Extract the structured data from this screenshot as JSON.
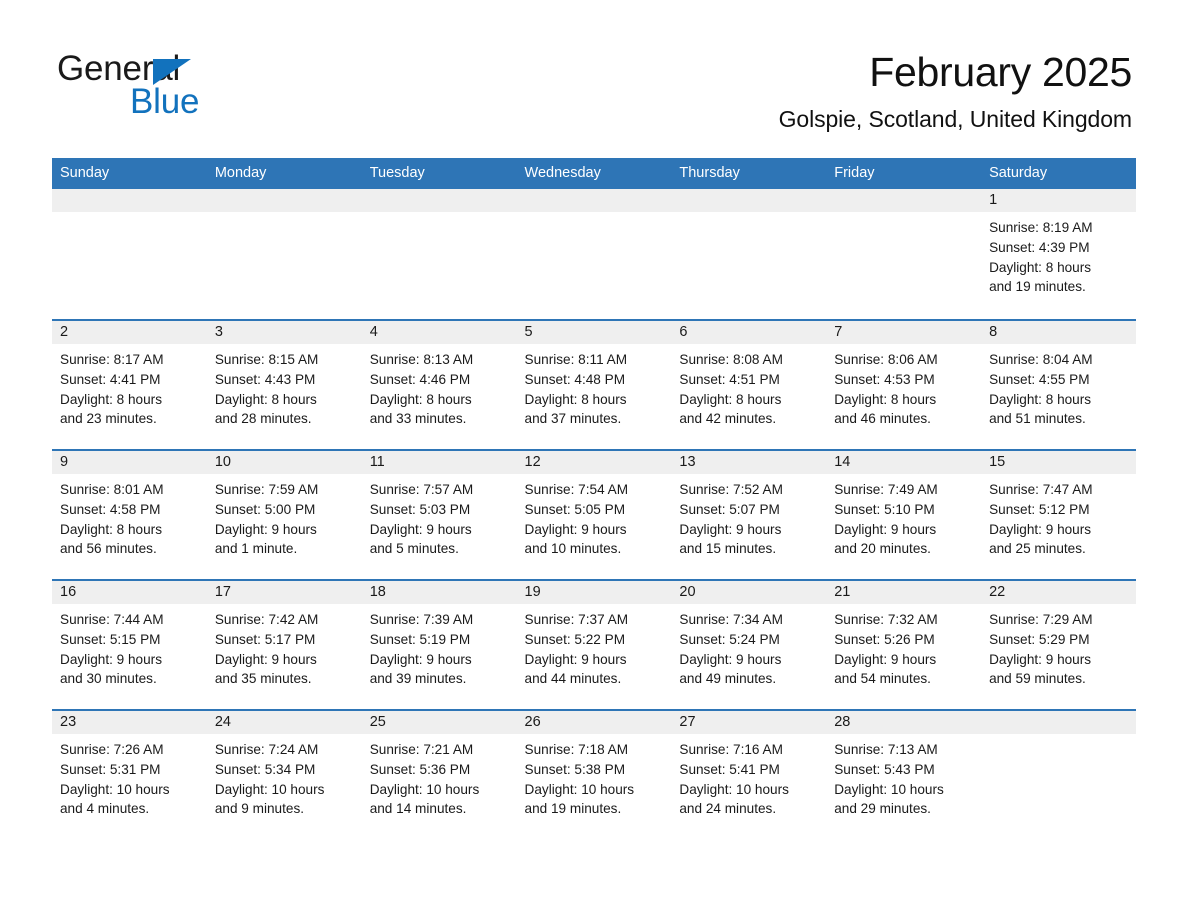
{
  "brand": {
    "name_part1": "General",
    "name_part2": "Blue",
    "logo_triangle": "triangle-icon",
    "accent_color": "#1272bd"
  },
  "header": {
    "title": "February 2025",
    "subtitle": "Golspie, Scotland, United Kingdom"
  },
  "theme": {
    "header_blue": "#2e75b6",
    "daynum_band": "#efefef",
    "text": "#1a1a1a"
  },
  "calendar": {
    "weekday_headers": [
      "Sunday",
      "Monday",
      "Tuesday",
      "Wednesday",
      "Thursday",
      "Friday",
      "Saturday"
    ],
    "weeks": [
      [
        {
          "day": "",
          "lines": []
        },
        {
          "day": "",
          "lines": []
        },
        {
          "day": "",
          "lines": []
        },
        {
          "day": "",
          "lines": []
        },
        {
          "day": "",
          "lines": []
        },
        {
          "day": "",
          "lines": []
        },
        {
          "day": "1",
          "lines": [
            "Sunrise: 8:19 AM",
            "Sunset: 4:39 PM",
            "Daylight: 8 hours",
            "and 19 minutes."
          ]
        }
      ],
      [
        {
          "day": "2",
          "lines": [
            "Sunrise: 8:17 AM",
            "Sunset: 4:41 PM",
            "Daylight: 8 hours",
            "and 23 minutes."
          ]
        },
        {
          "day": "3",
          "lines": [
            "Sunrise: 8:15 AM",
            "Sunset: 4:43 PM",
            "Daylight: 8 hours",
            "and 28 minutes."
          ]
        },
        {
          "day": "4",
          "lines": [
            "Sunrise: 8:13 AM",
            "Sunset: 4:46 PM",
            "Daylight: 8 hours",
            "and 33 minutes."
          ]
        },
        {
          "day": "5",
          "lines": [
            "Sunrise: 8:11 AM",
            "Sunset: 4:48 PM",
            "Daylight: 8 hours",
            "and 37 minutes."
          ]
        },
        {
          "day": "6",
          "lines": [
            "Sunrise: 8:08 AM",
            "Sunset: 4:51 PM",
            "Daylight: 8 hours",
            "and 42 minutes."
          ]
        },
        {
          "day": "7",
          "lines": [
            "Sunrise: 8:06 AM",
            "Sunset: 4:53 PM",
            "Daylight: 8 hours",
            "and 46 minutes."
          ]
        },
        {
          "day": "8",
          "lines": [
            "Sunrise: 8:04 AM",
            "Sunset: 4:55 PM",
            "Daylight: 8 hours",
            "and 51 minutes."
          ]
        }
      ],
      [
        {
          "day": "9",
          "lines": [
            "Sunrise: 8:01 AM",
            "Sunset: 4:58 PM",
            "Daylight: 8 hours",
            "and 56 minutes."
          ]
        },
        {
          "day": "10",
          "lines": [
            "Sunrise: 7:59 AM",
            "Sunset: 5:00 PM",
            "Daylight: 9 hours",
            "and 1 minute."
          ]
        },
        {
          "day": "11",
          "lines": [
            "Sunrise: 7:57 AM",
            "Sunset: 5:03 PM",
            "Daylight: 9 hours",
            "and 5 minutes."
          ]
        },
        {
          "day": "12",
          "lines": [
            "Sunrise: 7:54 AM",
            "Sunset: 5:05 PM",
            "Daylight: 9 hours",
            "and 10 minutes."
          ]
        },
        {
          "day": "13",
          "lines": [
            "Sunrise: 7:52 AM",
            "Sunset: 5:07 PM",
            "Daylight: 9 hours",
            "and 15 minutes."
          ]
        },
        {
          "day": "14",
          "lines": [
            "Sunrise: 7:49 AM",
            "Sunset: 5:10 PM",
            "Daylight: 9 hours",
            "and 20 minutes."
          ]
        },
        {
          "day": "15",
          "lines": [
            "Sunrise: 7:47 AM",
            "Sunset: 5:12 PM",
            "Daylight: 9 hours",
            "and 25 minutes."
          ]
        }
      ],
      [
        {
          "day": "16",
          "lines": [
            "Sunrise: 7:44 AM",
            "Sunset: 5:15 PM",
            "Daylight: 9 hours",
            "and 30 minutes."
          ]
        },
        {
          "day": "17",
          "lines": [
            "Sunrise: 7:42 AM",
            "Sunset: 5:17 PM",
            "Daylight: 9 hours",
            "and 35 minutes."
          ]
        },
        {
          "day": "18",
          "lines": [
            "Sunrise: 7:39 AM",
            "Sunset: 5:19 PM",
            "Daylight: 9 hours",
            "and 39 minutes."
          ]
        },
        {
          "day": "19",
          "lines": [
            "Sunrise: 7:37 AM",
            "Sunset: 5:22 PM",
            "Daylight: 9 hours",
            "and 44 minutes."
          ]
        },
        {
          "day": "20",
          "lines": [
            "Sunrise: 7:34 AM",
            "Sunset: 5:24 PM",
            "Daylight: 9 hours",
            "and 49 minutes."
          ]
        },
        {
          "day": "21",
          "lines": [
            "Sunrise: 7:32 AM",
            "Sunset: 5:26 PM",
            "Daylight: 9 hours",
            "and 54 minutes."
          ]
        },
        {
          "day": "22",
          "lines": [
            "Sunrise: 7:29 AM",
            "Sunset: 5:29 PM",
            "Daylight: 9 hours",
            "and 59 minutes."
          ]
        }
      ],
      [
        {
          "day": "23",
          "lines": [
            "Sunrise: 7:26 AM",
            "Sunset: 5:31 PM",
            "Daylight: 10 hours",
            "and 4 minutes."
          ]
        },
        {
          "day": "24",
          "lines": [
            "Sunrise: 7:24 AM",
            "Sunset: 5:34 PM",
            "Daylight: 10 hours",
            "and 9 minutes."
          ]
        },
        {
          "day": "25",
          "lines": [
            "Sunrise: 7:21 AM",
            "Sunset: 5:36 PM",
            "Daylight: 10 hours",
            "and 14 minutes."
          ]
        },
        {
          "day": "26",
          "lines": [
            "Sunrise: 7:18 AM",
            "Sunset: 5:38 PM",
            "Daylight: 10 hours",
            "and 19 minutes."
          ]
        },
        {
          "day": "27",
          "lines": [
            "Sunrise: 7:16 AM",
            "Sunset: 5:41 PM",
            "Daylight: 10 hours",
            "and 24 minutes."
          ]
        },
        {
          "day": "28",
          "lines": [
            "Sunrise: 7:13 AM",
            "Sunset: 5:43 PM",
            "Daylight: 10 hours",
            "and 29 minutes."
          ]
        },
        {
          "day": "",
          "lines": []
        }
      ]
    ]
  }
}
